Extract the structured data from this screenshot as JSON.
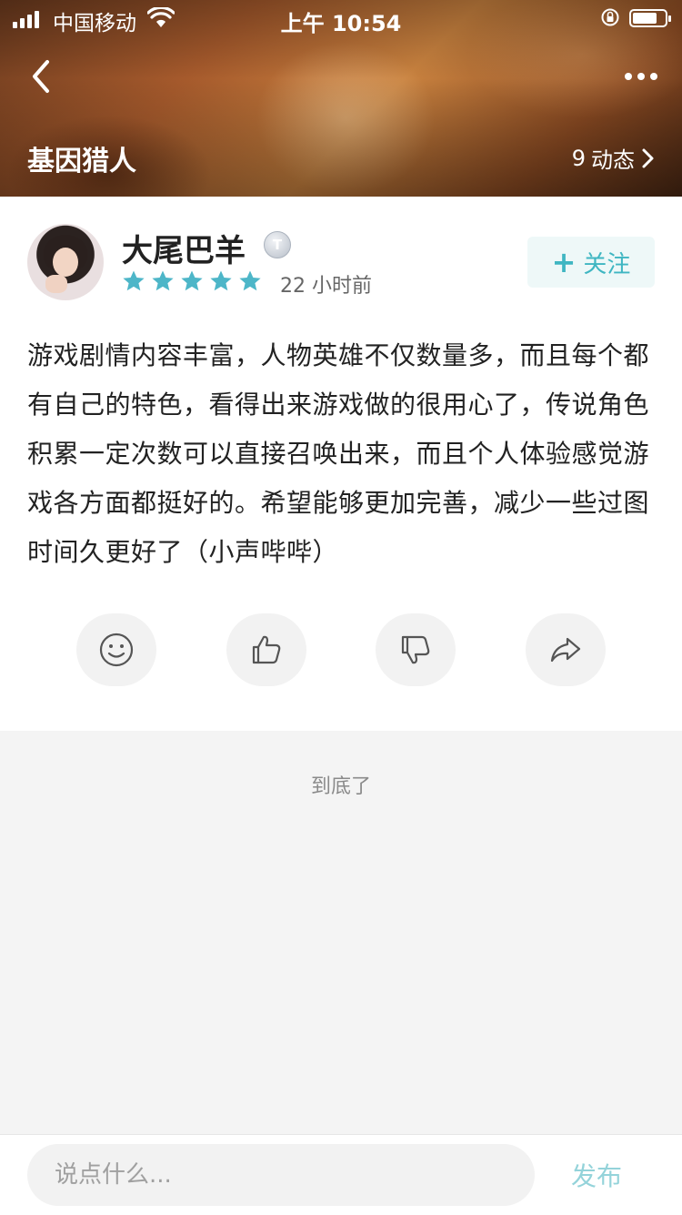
{
  "status_bar": {
    "carrier": "中国移动",
    "time": "上午 10:54",
    "battery_level": 0.75
  },
  "header": {
    "game_title": "基因猎人",
    "moments_count": "9",
    "moments_label": "动态"
  },
  "review": {
    "user_name": "大尾巴羊",
    "level_badge": "T",
    "rating": 5,
    "rating_max": 5,
    "time_ago": "22 小时前",
    "follow_label": "关注",
    "content": "游戏剧情内容丰富，人物英雄不仅数量多，而且每个都有自己的特色，看得出来游戏做的很用心了，传说角色积累一定次数可以直接召唤出来，而且个人体验感觉游戏各方面都挺好的。希望能够更加完善，减少一些过图时间久更好了（小声哔哔）",
    "actions": [
      "emoji-icon",
      "thumbs-up-icon",
      "thumbs-down-icon",
      "share-icon"
    ]
  },
  "footer": {
    "end_text": "到底了"
  },
  "comment_bar": {
    "placeholder": "说点什么...",
    "publish_label": "发布"
  },
  "colors": {
    "accent": "#3fb6c2",
    "star": "#4db6c8",
    "publish": "#94d3da"
  }
}
